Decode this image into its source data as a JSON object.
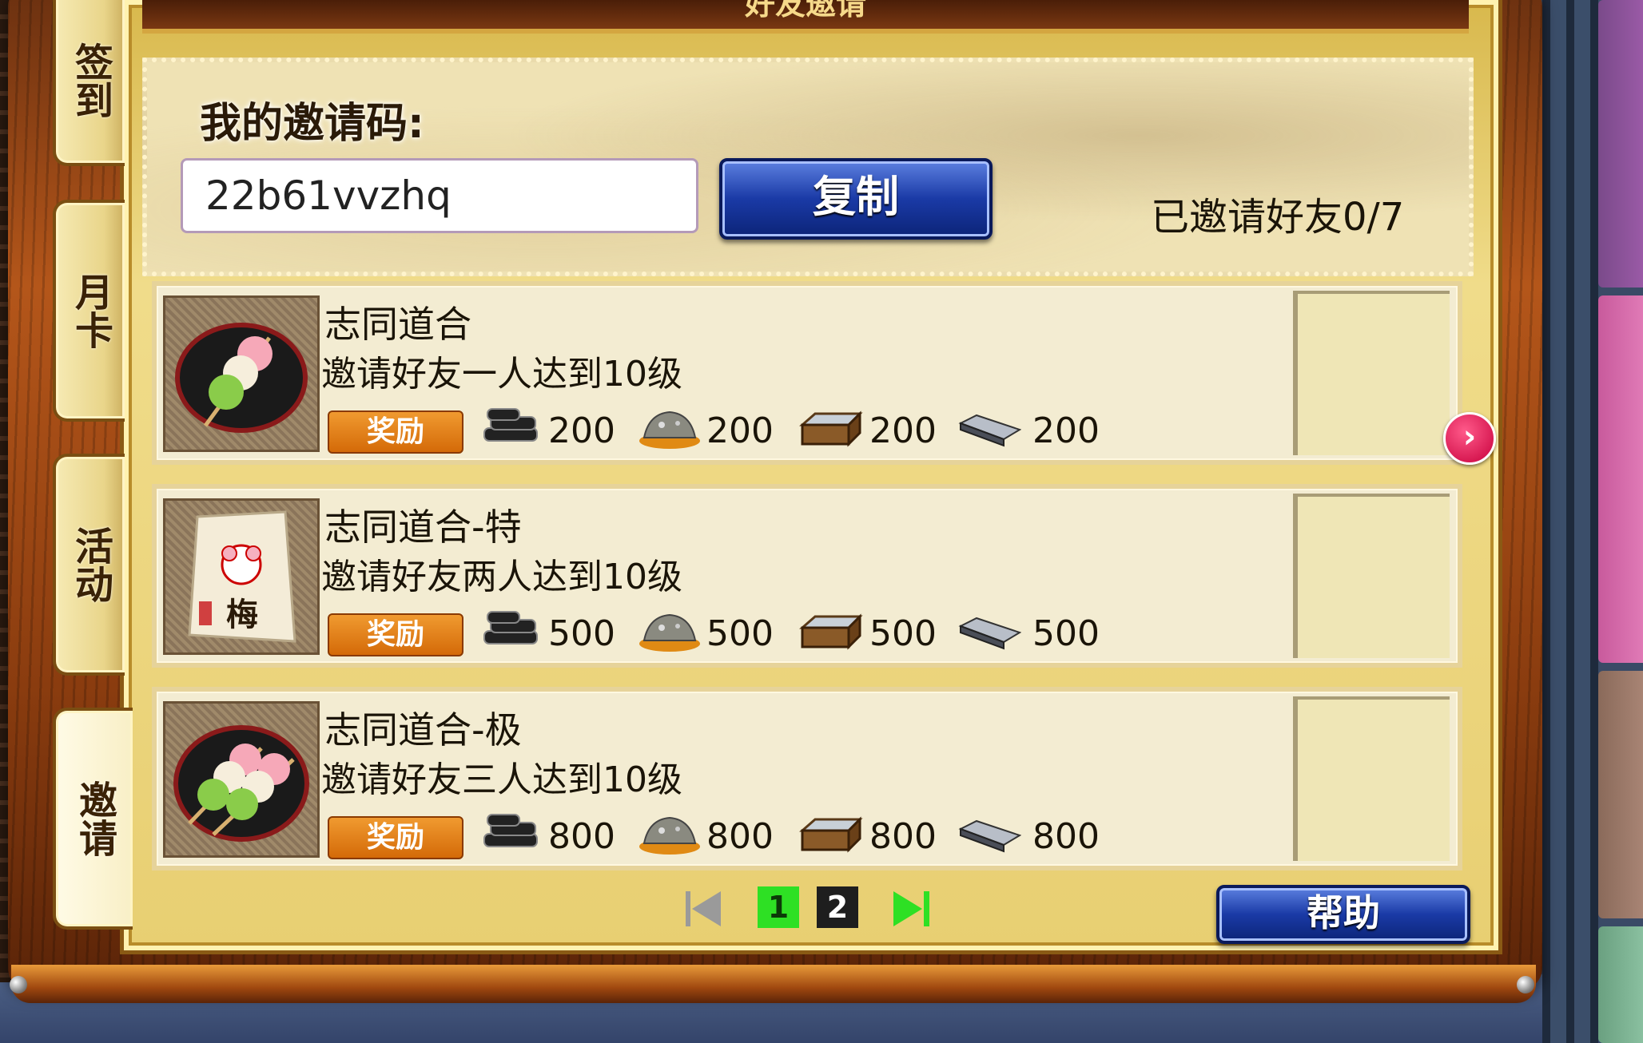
{
  "header": {
    "title": "好友邀请"
  },
  "tabs": [
    {
      "label": "签到",
      "active": false
    },
    {
      "label": "月卡",
      "active": false
    },
    {
      "label": "活动",
      "active": false
    },
    {
      "label": "邀请",
      "active": true
    }
  ],
  "invite": {
    "label": "我的邀请码:",
    "code": "22b61vvzhq",
    "copy_label": "复制",
    "invited_status": "已邀请好友0/7"
  },
  "tasks": [
    {
      "title": "志同道合",
      "desc": "邀请好友一人达到10级",
      "reward_label": "奖励",
      "icon": "dango-plate-icon",
      "rewards": [
        {
          "icon": "charcoal-icon",
          "value": "200"
        },
        {
          "icon": "ore-icon",
          "value": "200"
        },
        {
          "icon": "wood-box-icon",
          "value": "200"
        },
        {
          "icon": "iron-bar-icon",
          "value": "200"
        }
      ]
    },
    {
      "title": "志同道合-特",
      "desc": "邀请好友两人达到10级",
      "reward_label": "奖励",
      "icon": "mouse-charm-icon",
      "rewards": [
        {
          "icon": "charcoal-icon",
          "value": "500"
        },
        {
          "icon": "ore-icon",
          "value": "500"
        },
        {
          "icon": "wood-box-icon",
          "value": "500"
        },
        {
          "icon": "iron-bar-icon",
          "value": "500"
        }
      ]
    },
    {
      "title": "志同道合-极",
      "desc": "邀请好友三人达到10级",
      "reward_label": "奖励",
      "icon": "dango-plate-large-icon",
      "rewards": [
        {
          "icon": "charcoal-icon",
          "value": "800"
        },
        {
          "icon": "ore-icon",
          "value": "800"
        },
        {
          "icon": "wood-box-icon",
          "value": "800"
        },
        {
          "icon": "iron-bar-icon",
          "value": "800"
        }
      ]
    }
  ],
  "pager": {
    "pages": [
      "1",
      "2"
    ],
    "current": "1"
  },
  "help_label": "帮助",
  "charm_text": "梅",
  "colors": {
    "accent_blue": "#1a3aa6",
    "reward_orange": "#e07a14",
    "page_active": "#2ee024"
  }
}
